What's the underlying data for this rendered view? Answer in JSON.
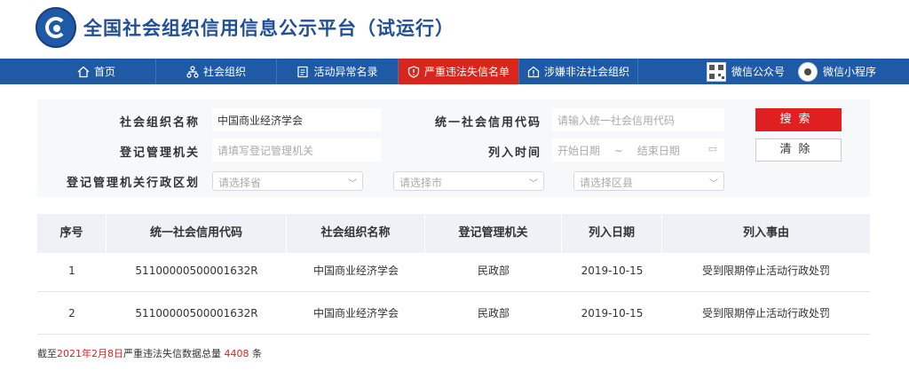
{
  "header": {
    "title": "全国社会组织信用信息公示平台（试运行）"
  },
  "nav": {
    "items": [
      {
        "label": "首页",
        "icon": "home-icon"
      },
      {
        "label": "社会组织",
        "icon": "org-tree-icon"
      },
      {
        "label": "活动异常名录",
        "icon": "list-icon"
      },
      {
        "label": "严重违法失信名单",
        "icon": "shield-alert-icon",
        "active": true
      },
      {
        "label": "涉嫌非法社会组织",
        "icon": "warning-house-icon"
      }
    ],
    "wechat_official": "微信公众号",
    "wechat_mini": "微信小程序"
  },
  "search": {
    "org_name_label": "社会组织名称",
    "org_name_value": "中国商业经济学会",
    "credit_code_label": "统一社会信用代码",
    "credit_code_placeholder": "请输入统一社会信用代码",
    "authority_label": "登记管理机关",
    "authority_placeholder": "请填写登记管理机关",
    "date_label": "列入时间",
    "date_start_placeholder": "开始日期",
    "date_sep": "~",
    "date_end_placeholder": "结束日期",
    "region_label": "登记管理机关行政区划",
    "province_placeholder": "请选择省",
    "city_placeholder": "请选择市",
    "county_placeholder": "请选择区县",
    "search_button": "搜索",
    "clear_button": "清除"
  },
  "table": {
    "headers": [
      "序号",
      "统一社会信用代码",
      "社会组织名称",
      "登记管理机关",
      "列入日期",
      "列入事由"
    ],
    "rows": [
      [
        "1",
        "51100000500001632R",
        "中国商业经济学会",
        "民政部",
        "2019-10-15",
        "受到限期停止活动行政处罚"
      ],
      [
        "2",
        "51100000500001632R",
        "中国商业经济学会",
        "民政部",
        "2019-10-15",
        "受到限期停止活动行政处罚"
      ]
    ]
  },
  "footer": {
    "prefix": "截至",
    "date": "2021年2月8日",
    "middle": "严重违法失信数据总量 ",
    "count": "4408",
    "suffix": " 条"
  },
  "colors": {
    "brand_blue": "#1f5aa6",
    "alert_red": "#e02020",
    "title_blue": "#1f4f97"
  }
}
